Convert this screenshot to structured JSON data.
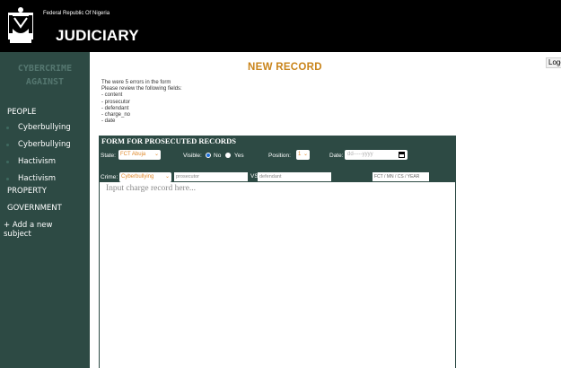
{
  "header": {
    "gov_text": "Federal Republic Of Nigeria",
    "title": "JUDICIARY"
  },
  "sidebar": {
    "title_line1": "CYBERCRIME",
    "title_line2": "AGAINST",
    "items": [
      {
        "label": "PEOPLE"
      },
      {
        "label": "Cyberbullying"
      },
      {
        "label": "Cyberbullying"
      },
      {
        "label": "Hactivism"
      },
      {
        "label": "Hactivism"
      },
      {
        "label": "PROPERTY"
      },
      {
        "label": "GOVERNMENT"
      },
      {
        "label": "+ Add a new"
      },
      {
        "label": "subject"
      }
    ]
  },
  "logout_label": "Logo",
  "main": {
    "title": "NEW RECORD",
    "errors": [
      "The were 5 errors in the form",
      "Please review the following fields:",
      "- content",
      "- prosecutor",
      "- defendant",
      "- charge_no",
      "- date"
    ]
  },
  "form": {
    "heading": "FORM FOR PROSECUTED RECORDS",
    "state_label": "State:",
    "state_value": "FCT Abuja",
    "visible_label": "Visible:",
    "no_label": "No",
    "yes_label": "Yes",
    "position_label": "Position:",
    "position_value": "1",
    "date_label": "Date:",
    "date_placeholder": "dd-----yyyy",
    "crime_label": "Crime:",
    "crime_value": "Cyberbullying",
    "prosecutor_placeholder": "prosecutor",
    "vs_label": "VS",
    "defendant_placeholder": "defendant",
    "charge_placeholder": "FCT / MN / CS / YEAR",
    "content_placeholder": "Input charge record here..."
  },
  "colors": {
    "header_bg": "#000000",
    "panel_bg": "#2d4a44",
    "accent": "#c9841a",
    "radio_selected": "#1e6fd9"
  }
}
